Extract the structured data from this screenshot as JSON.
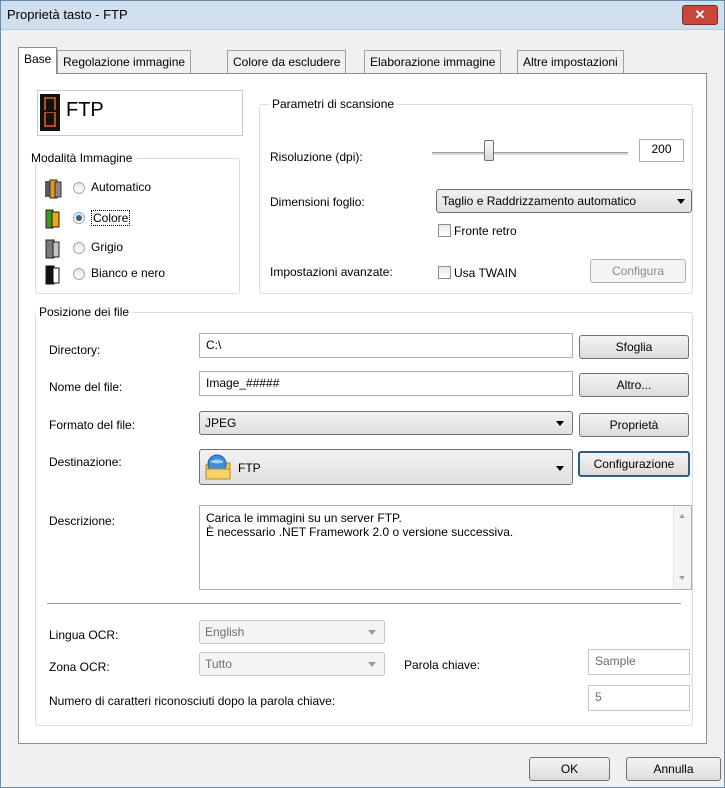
{
  "window": {
    "title": "Proprietà tasto - FTP",
    "close_glyph": "✕"
  },
  "tabs": [
    "Base",
    "Regolazione immagine",
    "Colore da escludere",
    "Elaborazione immagine",
    "Altre impostazioni"
  ],
  "button_name": {
    "digit": "",
    "label": "FTP"
  },
  "image_mode": {
    "legend": "Modalità Immagine",
    "options": [
      "Automatico",
      "Colore",
      "Grigio",
      "Bianco e nero"
    ],
    "selected": "Colore"
  },
  "scan_params": {
    "legend": "Parametri di scansione",
    "resolution_label": "Risoluzione (dpi):",
    "resolution_value": "200",
    "paper_size_label": "Dimensioni foglio:",
    "paper_size_value": "Taglio e Raddrizzamento automatico",
    "duplex_label": "Fronte retro",
    "duplex_checked": false,
    "advanced_label": "Impostazioni avanzate:",
    "twain_label": "Usa TWAIN",
    "twain_checked": false,
    "configure_label": "Configura"
  },
  "file_location": {
    "legend": "Posizione dei file",
    "directory_label": "Directory:",
    "directory_value": "C:\\",
    "browse_label": "Sfoglia",
    "filename_label": "Nome del file:",
    "filename_value": "Image_#####",
    "more_label": "Altro...",
    "format_label": "Formato del file:",
    "format_value": "JPEG",
    "properties_label": "Proprietà",
    "destination_label": "Destinazione:",
    "destination_value": "FTP",
    "configuration_label": "Configurazione",
    "description_label": "Descrizione:",
    "description_line1": "Carica le immagini su un server FTP.",
    "description_line2": "È necessario .NET Framework 2.0 o versione successiva.",
    "ocr_language_label": "Lingua OCR:",
    "ocr_language_value": "English",
    "ocr_zone_label": "Zona OCR:",
    "ocr_zone_value": "Tutto",
    "keyword_label": "Parola chiave:",
    "keyword_value": "Sample",
    "chars_after_keyword_label": "Numero di caratteri riconosciuti dopo la parola chiave:",
    "chars_after_keyword_value": "5"
  },
  "footer": {
    "ok_label": "OK",
    "cancel_label": "Annulla"
  },
  "slider": {
    "min": 0,
    "max": 1,
    "position_fraction": 0.29
  },
  "colors": {
    "accent": "#2c628b",
    "focus_border": "#2b5d8b",
    "title_bar": "#cfdfee",
    "close_button": "#c9463d"
  }
}
